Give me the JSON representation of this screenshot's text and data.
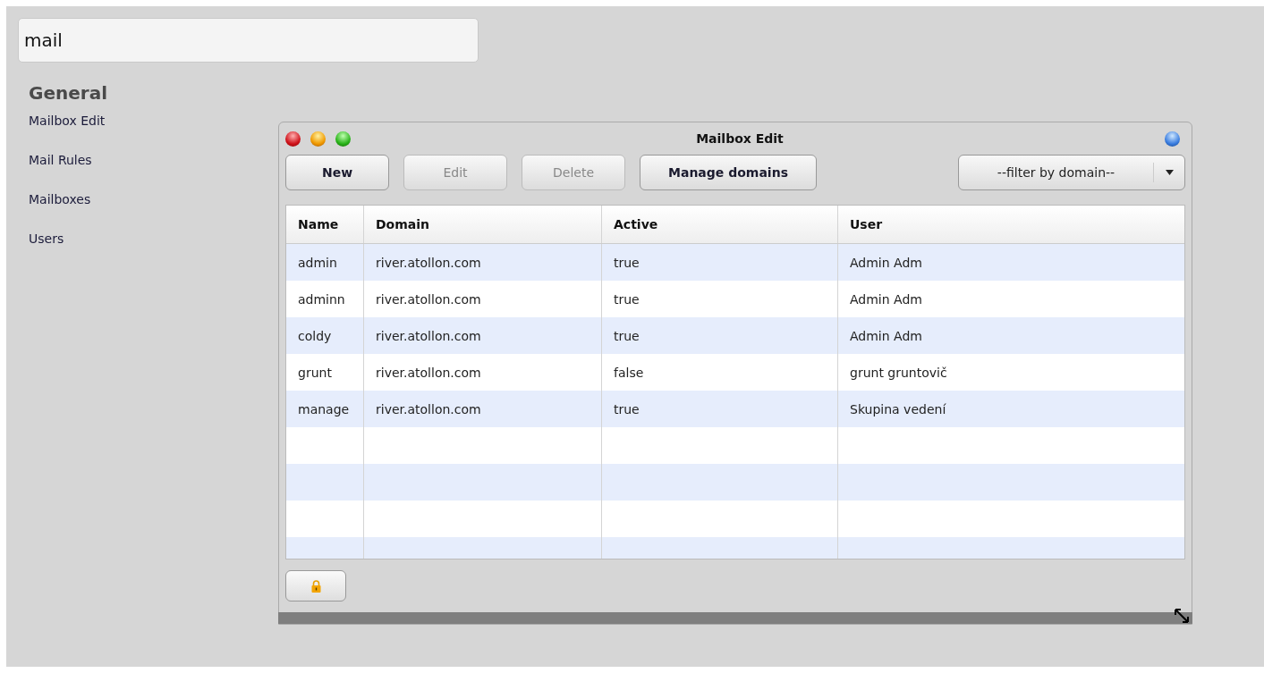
{
  "search": {
    "value": "mail"
  },
  "sidebar": {
    "heading": "General",
    "items": [
      {
        "label": "Mailbox Edit"
      },
      {
        "label": "Mail Rules"
      },
      {
        "label": "Mailboxes"
      },
      {
        "label": "Users"
      }
    ]
  },
  "window": {
    "title": "Mailbox Edit",
    "toolbar": {
      "buttons": [
        {
          "label": "New",
          "disabled": false
        },
        {
          "label": "Edit",
          "disabled": true
        },
        {
          "label": "Delete",
          "disabled": true
        },
        {
          "label": "Manage domains",
          "disabled": false
        }
      ],
      "filter": {
        "value": "--filter by domain--"
      }
    },
    "table": {
      "columns": [
        "Name",
        "Domain",
        "Active",
        "User"
      ],
      "rows": [
        [
          "admin",
          "river.atollon.com",
          "true",
          "Admin Adm"
        ],
        [
          "adminn",
          "river.atollon.com",
          "true",
          "Admin Adm"
        ],
        [
          "coldy",
          "river.atollon.com",
          "true",
          "Admin Adm"
        ],
        [
          "grunt",
          "river.atollon.com",
          "false",
          "grunt gruntovič"
        ],
        [
          "manage",
          "river.atollon.com",
          "true",
          "Skupina vedení"
        ]
      ]
    }
  }
}
